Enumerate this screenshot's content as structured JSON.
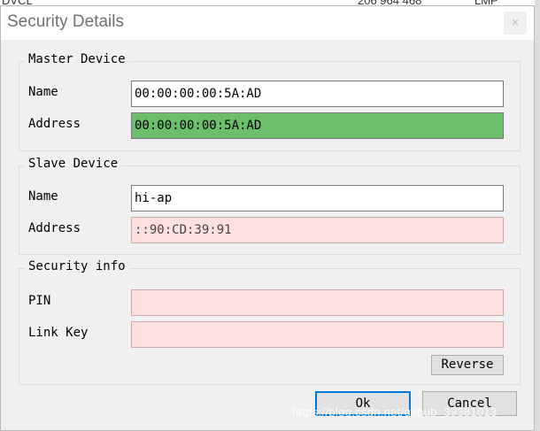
{
  "background": {
    "left_text": "DVCL",
    "number_text": "206 964 468",
    "right_text": "LMP"
  },
  "dialog": {
    "title": "Security Details",
    "close_label": "×"
  },
  "master_device": {
    "title": "Master Device",
    "name_label": "Name",
    "name_value": "00:00:00:00:5A:AD",
    "address_label": "Address",
    "address_value": "00:00:00:00:5A:AD"
  },
  "slave_device": {
    "title": "Slave Device",
    "name_label": "Name",
    "name_value": "hi-ap",
    "address_label": "Address",
    "address_value": "::90:CD:39:91"
  },
  "security_info": {
    "title": "Security info",
    "pin_label": "PIN",
    "pin_value": "",
    "link_key_label": "Link Key",
    "link_key_value": "",
    "reverse_label": "Reverse"
  },
  "buttons": {
    "ok_label": "Ok",
    "cancel_label": "Cancel"
  },
  "watermark": "https://blog.csdn.net/github_39381013",
  "colors": {
    "address_ok": "#6cbe6c",
    "invalid_field": "#ffe0e0",
    "focus_border": "#0078d7"
  }
}
